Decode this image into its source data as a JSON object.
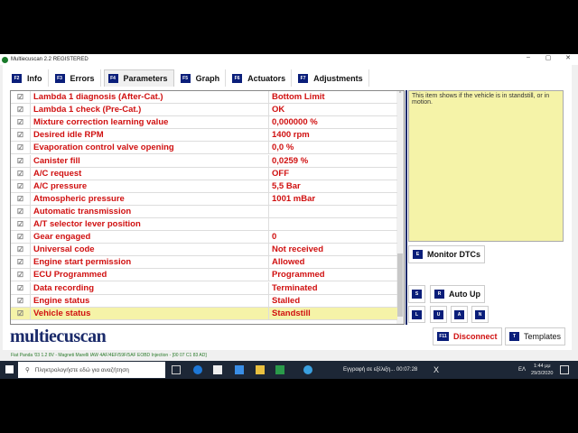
{
  "window": {
    "title": "Multiecuscan 2.2 REGISTERED",
    "controls": [
      "–",
      "▢",
      "✕"
    ]
  },
  "tabs": [
    {
      "key": "F2",
      "label": "Info"
    },
    {
      "key": "F3",
      "label": "Errors"
    },
    {
      "key": "F4",
      "label": "Parameters",
      "active": true
    },
    {
      "key": "F5",
      "label": "Graph"
    },
    {
      "key": "F6",
      "label": "Actuators"
    },
    {
      "key": "F7",
      "label": "Adjustments"
    }
  ],
  "parameters": [
    {
      "check": "☑",
      "name": "Lambda 1 diagnosis (After-Cat.)",
      "value": "Bottom Limit"
    },
    {
      "check": "☑",
      "name": "Lambda 1 check (Pre-Cat.)",
      "value": "OK"
    },
    {
      "check": "☑",
      "name": "Mixture correction learning value",
      "value": "0,000000 %"
    },
    {
      "check": "☑",
      "name": "Desired idle RPM",
      "value": "1400 rpm"
    },
    {
      "check": "☑",
      "name": "Evaporation control valve opening",
      "value": "0,0 %"
    },
    {
      "check": "☑",
      "name": "Canister fill",
      "value": "0,0259 %"
    },
    {
      "check": "☑",
      "name": "A/C request",
      "value": "OFF"
    },
    {
      "check": "☑",
      "name": "A/C pressure",
      "value": "5,5 Bar"
    },
    {
      "check": "☑",
      "name": "Atmospheric pressure",
      "value": "1001 mBar"
    },
    {
      "check": "☑",
      "name": "Automatic transmission",
      "value": ""
    },
    {
      "check": "☑",
      "name": "A/T selector lever position",
      "value": ""
    },
    {
      "check": "☑",
      "name": "Gear engaged",
      "value": "0"
    },
    {
      "check": "☑",
      "name": "Universal code",
      "value": "Not received"
    },
    {
      "check": "☑",
      "name": "Engine start permission",
      "value": "Allowed"
    },
    {
      "check": "☑",
      "name": "ECU Programmed",
      "value": "Programmed"
    },
    {
      "check": "☑",
      "name": "Data recording",
      "value": "Terminated"
    },
    {
      "check": "☑",
      "name": "Engine status",
      "value": "Stalled"
    },
    {
      "check": "☑",
      "name": "Vehicle status",
      "value": "Standstill",
      "selected": true
    }
  ],
  "info_text": "This item shows if the vehicle is in standstill, or in motion.",
  "buttons": {
    "monitor": {
      "key": "E",
      "label": "Monitor DTCs"
    },
    "s": {
      "key": "S"
    },
    "autoup": {
      "key": "R",
      "label": "Auto Up"
    },
    "l": {
      "key": "L"
    },
    "u": {
      "key": "U"
    },
    "a": {
      "key": "A"
    },
    "n": {
      "key": "N"
    },
    "disconnect": {
      "key": "F11",
      "label": "Disconnect"
    },
    "templates": {
      "key": "T",
      "label": "Templates"
    }
  },
  "logo": "multiecuscan",
  "status_bar": "Fiat Panda '03 1.2 8V - Magneti Marelli IAW 4AF/4EF/59F/5AF EOBD Injection - [00 07 C1 83 AD]",
  "taskbar": {
    "search_placeholder": "Πληκτρολογήστε εδώ για αναζήτηση",
    "recording": "Εγγραφή σε εξέλιξη... 00:07:28",
    "close": "X",
    "lang": "ΕΛ",
    "time": "1:44 μμ",
    "date": "29/3/2020"
  },
  "colors": {
    "param_text": "#d01010",
    "key_bg": "#0a1e7a",
    "selected_row": "#f5f3a8",
    "taskbar": "#1d2736"
  }
}
